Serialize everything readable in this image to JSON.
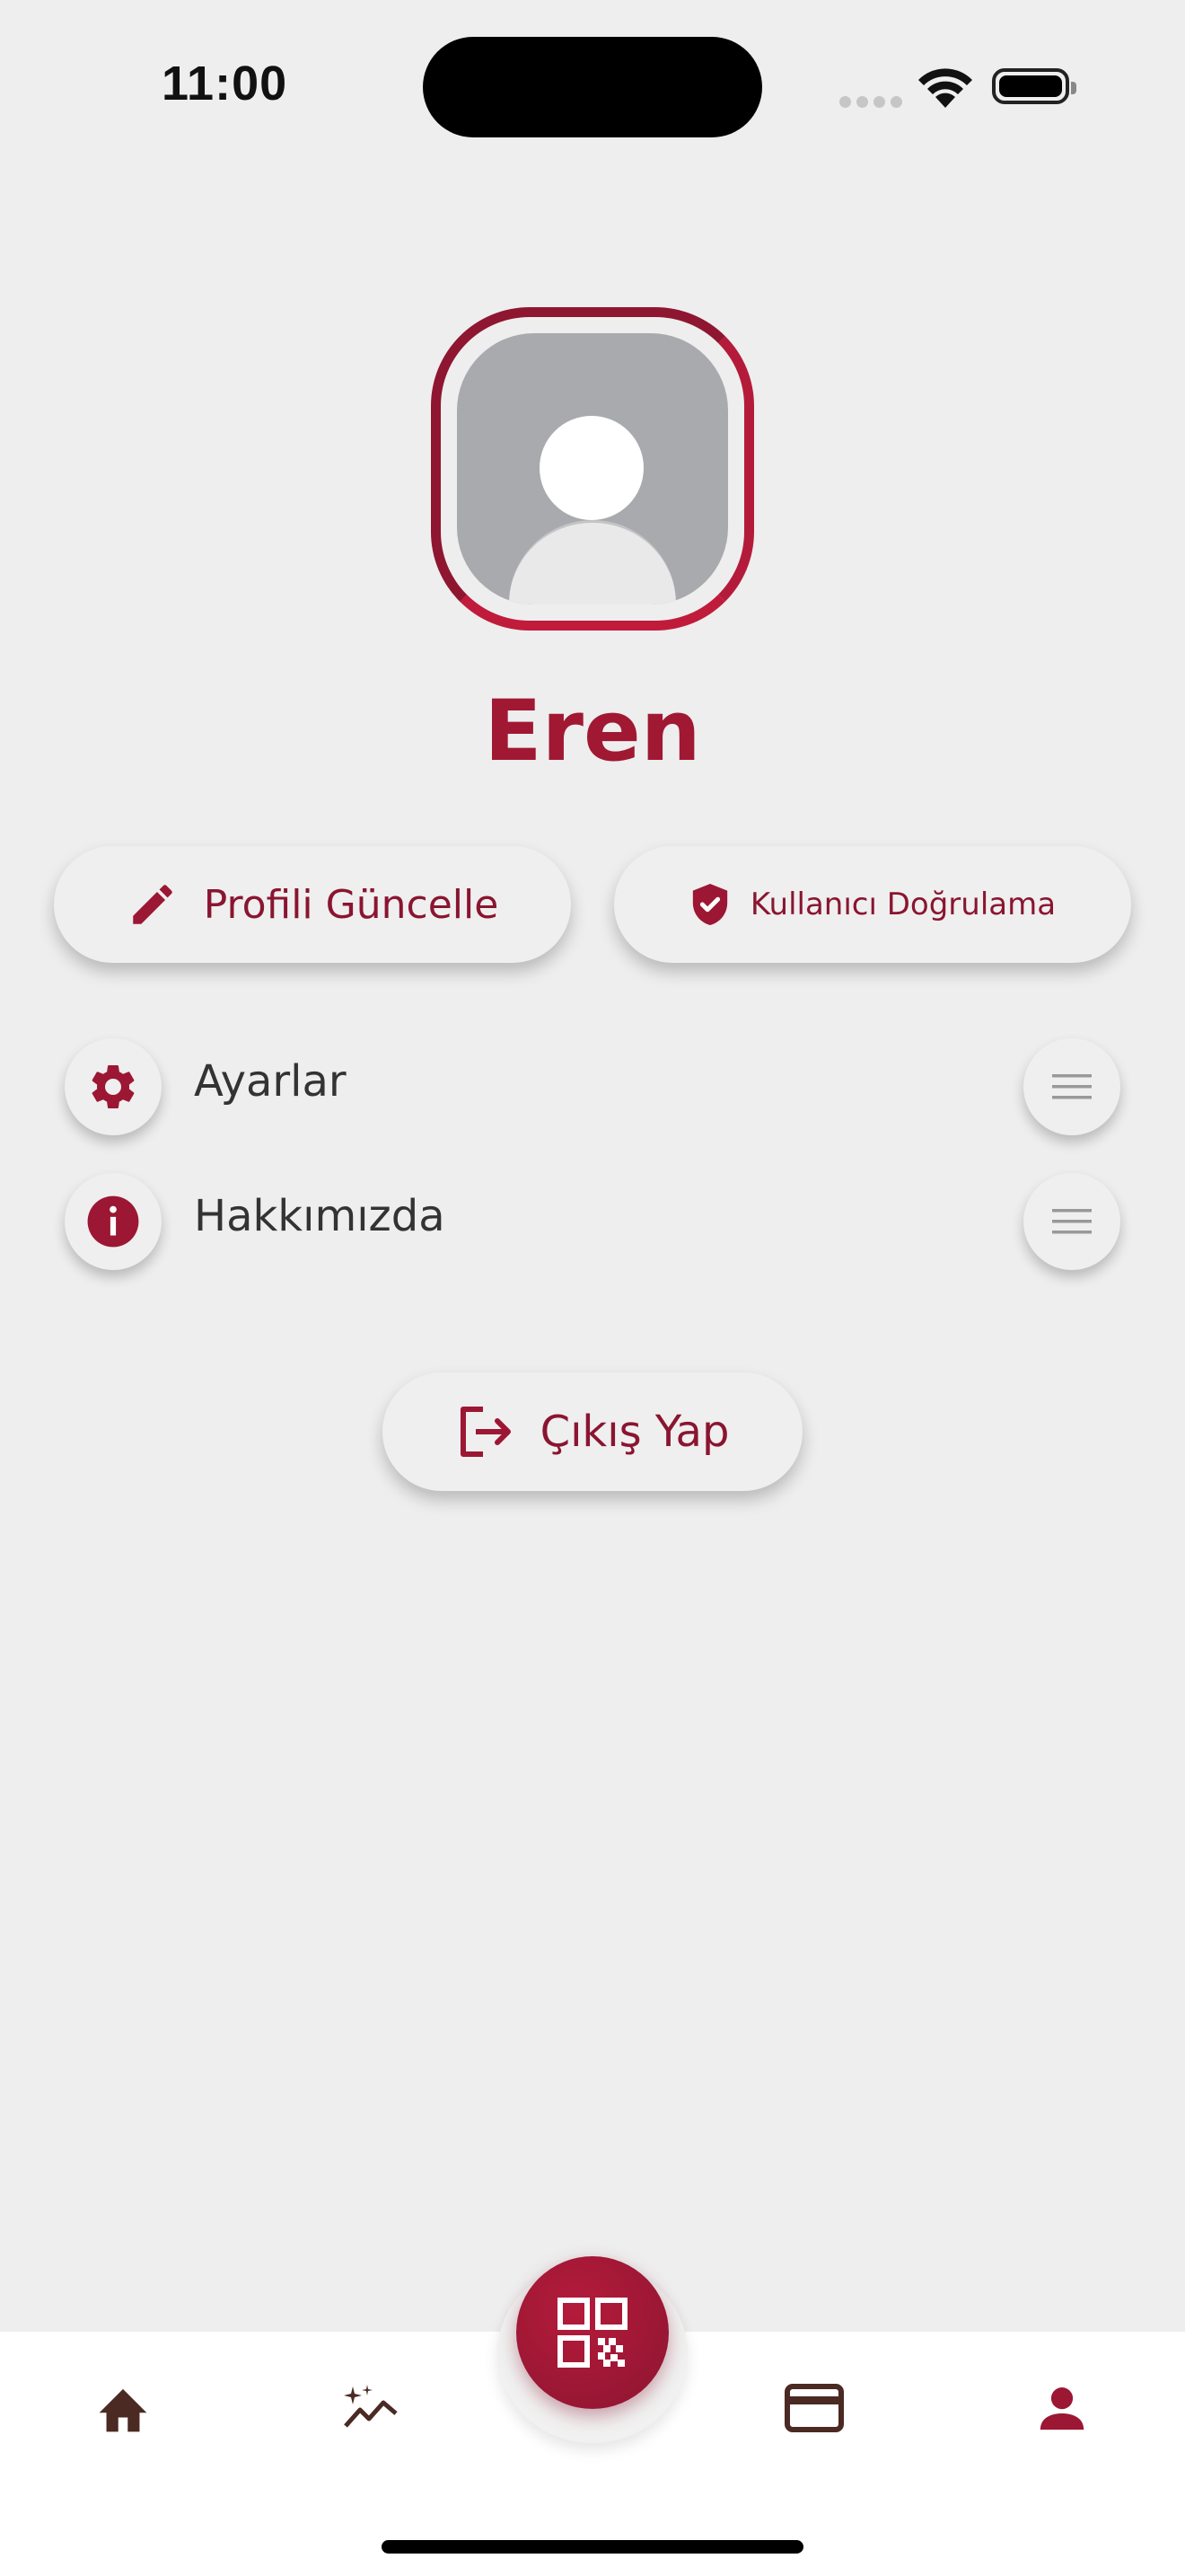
{
  "status_bar": {
    "time": "11:00"
  },
  "profile": {
    "name": "Eren"
  },
  "actions": {
    "edit_profile": "Profili Güncelle",
    "verify_user": "Kullanıcı Doğrulama",
    "logout": "Çıkış Yap"
  },
  "menu": {
    "items": [
      {
        "label": "Ayarlar",
        "icon": "gear-icon"
      },
      {
        "label": "Hakkımızda",
        "icon": "info-icon"
      }
    ]
  },
  "nav": {
    "items": [
      {
        "icon": "home-icon",
        "active": false
      },
      {
        "icon": "sparkle-chart-icon",
        "active": false
      },
      {
        "icon": "qr-code-icon",
        "active": false
      },
      {
        "icon": "credit-card-icon",
        "active": false
      },
      {
        "icon": "person-icon",
        "active": true
      }
    ]
  },
  "colors": {
    "accent": "#a11833",
    "background": "#eeeeee",
    "nav_icon": "#4a2a22"
  }
}
